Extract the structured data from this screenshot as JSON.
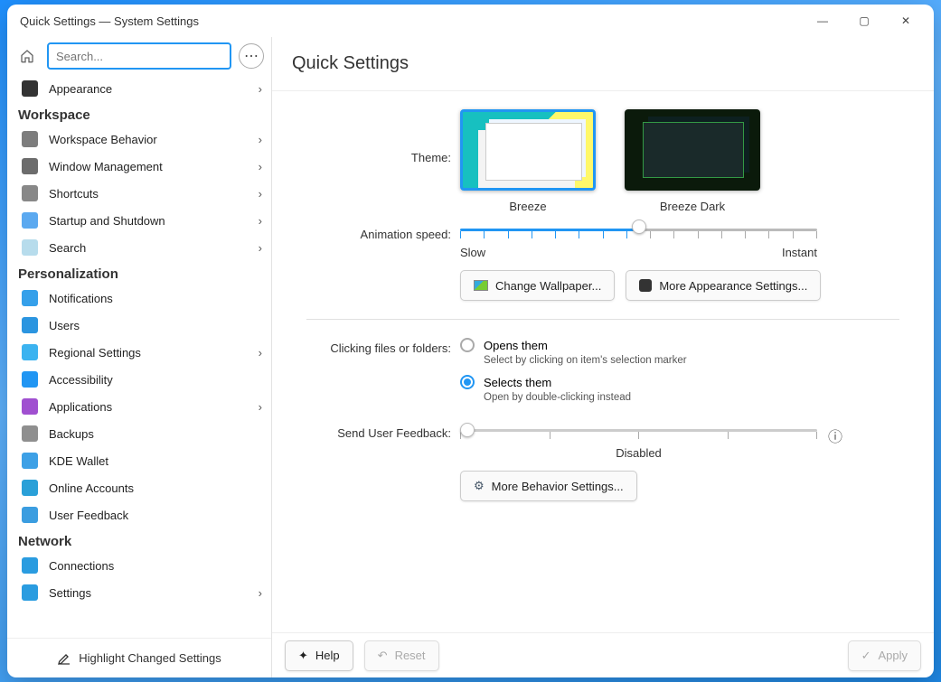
{
  "window": {
    "title": "Quick Settings — System Settings"
  },
  "search": {
    "placeholder": "Search..."
  },
  "page": {
    "title": "Quick Settings"
  },
  "sidebar": {
    "top_item": {
      "label": "Appearance"
    },
    "sections": [
      {
        "header": "Workspace",
        "items": [
          {
            "label": "Workspace Behavior",
            "arrow": true,
            "icon_bg": "#7d7d7d"
          },
          {
            "label": "Window Management",
            "arrow": true,
            "icon_bg": "#6c6c6c"
          },
          {
            "label": "Shortcuts",
            "arrow": true,
            "icon_bg": "#888888"
          },
          {
            "label": "Startup and Shutdown",
            "arrow": true,
            "icon_bg": "#5ba9f0"
          },
          {
            "label": "Search",
            "arrow": true,
            "icon_bg": "#b7dcec"
          }
        ]
      },
      {
        "header": "Personalization",
        "items": [
          {
            "label": "Notifications",
            "arrow": false,
            "icon_bg": "#35a0ea"
          },
          {
            "label": "Users",
            "arrow": false,
            "icon_bg": "#2b95e0"
          },
          {
            "label": "Regional Settings",
            "arrow": true,
            "icon_bg": "#3bb3f0"
          },
          {
            "label": "Accessibility",
            "arrow": false,
            "icon_bg": "#2196f3"
          },
          {
            "label": "Applications",
            "arrow": true,
            "icon_bg": "#a050d0"
          },
          {
            "label": "Backups",
            "arrow": false,
            "icon_bg": "#8f8f8f"
          },
          {
            "label": "KDE Wallet",
            "arrow": false,
            "icon_bg": "#3da0e6"
          },
          {
            "label": "Online Accounts",
            "arrow": false,
            "icon_bg": "#2aa0d8"
          },
          {
            "label": "User Feedback",
            "arrow": false,
            "icon_bg": "#3b9de0"
          }
        ]
      },
      {
        "header": "Network",
        "items": [
          {
            "label": "Connections",
            "arrow": false,
            "icon_bg": "#2a9ce0"
          },
          {
            "label": "Settings",
            "arrow": true,
            "icon_bg": "#2a9ce0"
          }
        ]
      }
    ],
    "highlight_btn": "Highlight Changed Settings"
  },
  "theme": {
    "label": "Theme:",
    "options": [
      {
        "name": "Breeze",
        "selected": true
      },
      {
        "name": "Breeze Dark",
        "selected": false
      }
    ]
  },
  "animation": {
    "label": "Animation speed:",
    "slow": "Slow",
    "instant": "Instant",
    "pct": 50
  },
  "buttons": {
    "wallpaper": "Change Wallpaper...",
    "appearance": "More Appearance Settings...",
    "behavior": "More Behavior Settings..."
  },
  "clicking": {
    "label": "Clicking files or folders:",
    "opt1": "Opens them",
    "opt1_sub": "Select by clicking on item's selection marker",
    "opt2": "Selects them",
    "opt2_sub": "Open by double-clicking instead",
    "selected": 2
  },
  "feedback": {
    "label": "Send User Feedback:",
    "status": "Disabled"
  },
  "bottom": {
    "help": "Help",
    "reset": "Reset",
    "apply": "Apply"
  }
}
